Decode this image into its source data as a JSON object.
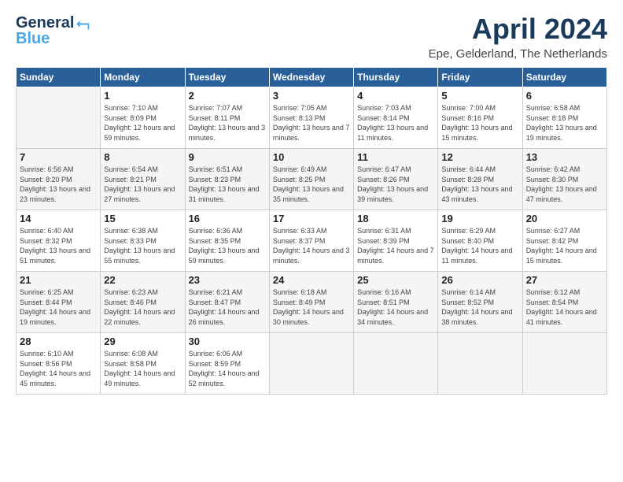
{
  "logo": {
    "line1": "General",
    "line2": "Blue"
  },
  "title": "April 2024",
  "subtitle": "Epe, Gelderland, The Netherlands",
  "weekdays": [
    "Sunday",
    "Monday",
    "Tuesday",
    "Wednesday",
    "Thursday",
    "Friday",
    "Saturday"
  ],
  "weeks": [
    [
      {
        "day": "",
        "sunrise": "",
        "sunset": "",
        "daylight": ""
      },
      {
        "day": "1",
        "sunrise": "Sunrise: 7:10 AM",
        "sunset": "Sunset: 8:09 PM",
        "daylight": "Daylight: 12 hours and 59 minutes."
      },
      {
        "day": "2",
        "sunrise": "Sunrise: 7:07 AM",
        "sunset": "Sunset: 8:11 PM",
        "daylight": "Daylight: 13 hours and 3 minutes."
      },
      {
        "day": "3",
        "sunrise": "Sunrise: 7:05 AM",
        "sunset": "Sunset: 8:13 PM",
        "daylight": "Daylight: 13 hours and 7 minutes."
      },
      {
        "day": "4",
        "sunrise": "Sunrise: 7:03 AM",
        "sunset": "Sunset: 8:14 PM",
        "daylight": "Daylight: 13 hours and 11 minutes."
      },
      {
        "day": "5",
        "sunrise": "Sunrise: 7:00 AM",
        "sunset": "Sunset: 8:16 PM",
        "daylight": "Daylight: 13 hours and 15 minutes."
      },
      {
        "day": "6",
        "sunrise": "Sunrise: 6:58 AM",
        "sunset": "Sunset: 8:18 PM",
        "daylight": "Daylight: 13 hours and 19 minutes."
      }
    ],
    [
      {
        "day": "7",
        "sunrise": "Sunrise: 6:56 AM",
        "sunset": "Sunset: 8:20 PM",
        "daylight": "Daylight: 13 hours and 23 minutes."
      },
      {
        "day": "8",
        "sunrise": "Sunrise: 6:54 AM",
        "sunset": "Sunset: 8:21 PM",
        "daylight": "Daylight: 13 hours and 27 minutes."
      },
      {
        "day": "9",
        "sunrise": "Sunrise: 6:51 AM",
        "sunset": "Sunset: 8:23 PM",
        "daylight": "Daylight: 13 hours and 31 minutes."
      },
      {
        "day": "10",
        "sunrise": "Sunrise: 6:49 AM",
        "sunset": "Sunset: 8:25 PM",
        "daylight": "Daylight: 13 hours and 35 minutes."
      },
      {
        "day": "11",
        "sunrise": "Sunrise: 6:47 AM",
        "sunset": "Sunset: 8:26 PM",
        "daylight": "Daylight: 13 hours and 39 minutes."
      },
      {
        "day": "12",
        "sunrise": "Sunrise: 6:44 AM",
        "sunset": "Sunset: 8:28 PM",
        "daylight": "Daylight: 13 hours and 43 minutes."
      },
      {
        "day": "13",
        "sunrise": "Sunrise: 6:42 AM",
        "sunset": "Sunset: 8:30 PM",
        "daylight": "Daylight: 13 hours and 47 minutes."
      }
    ],
    [
      {
        "day": "14",
        "sunrise": "Sunrise: 6:40 AM",
        "sunset": "Sunset: 8:32 PM",
        "daylight": "Daylight: 13 hours and 51 minutes."
      },
      {
        "day": "15",
        "sunrise": "Sunrise: 6:38 AM",
        "sunset": "Sunset: 8:33 PM",
        "daylight": "Daylight: 13 hours and 55 minutes."
      },
      {
        "day": "16",
        "sunrise": "Sunrise: 6:36 AM",
        "sunset": "Sunset: 8:35 PM",
        "daylight": "Daylight: 13 hours and 59 minutes."
      },
      {
        "day": "17",
        "sunrise": "Sunrise: 6:33 AM",
        "sunset": "Sunset: 8:37 PM",
        "daylight": "Daylight: 14 hours and 3 minutes."
      },
      {
        "day": "18",
        "sunrise": "Sunrise: 6:31 AM",
        "sunset": "Sunset: 8:39 PM",
        "daylight": "Daylight: 14 hours and 7 minutes."
      },
      {
        "day": "19",
        "sunrise": "Sunrise: 6:29 AM",
        "sunset": "Sunset: 8:40 PM",
        "daylight": "Daylight: 14 hours and 11 minutes."
      },
      {
        "day": "20",
        "sunrise": "Sunrise: 6:27 AM",
        "sunset": "Sunset: 8:42 PM",
        "daylight": "Daylight: 14 hours and 15 minutes."
      }
    ],
    [
      {
        "day": "21",
        "sunrise": "Sunrise: 6:25 AM",
        "sunset": "Sunset: 8:44 PM",
        "daylight": "Daylight: 14 hours and 19 minutes."
      },
      {
        "day": "22",
        "sunrise": "Sunrise: 6:23 AM",
        "sunset": "Sunset: 8:46 PM",
        "daylight": "Daylight: 14 hours and 22 minutes."
      },
      {
        "day": "23",
        "sunrise": "Sunrise: 6:21 AM",
        "sunset": "Sunset: 8:47 PM",
        "daylight": "Daylight: 14 hours and 26 minutes."
      },
      {
        "day": "24",
        "sunrise": "Sunrise: 6:18 AM",
        "sunset": "Sunset: 8:49 PM",
        "daylight": "Daylight: 14 hours and 30 minutes."
      },
      {
        "day": "25",
        "sunrise": "Sunrise: 6:16 AM",
        "sunset": "Sunset: 8:51 PM",
        "daylight": "Daylight: 14 hours and 34 minutes."
      },
      {
        "day": "26",
        "sunrise": "Sunrise: 6:14 AM",
        "sunset": "Sunset: 8:52 PM",
        "daylight": "Daylight: 14 hours and 38 minutes."
      },
      {
        "day": "27",
        "sunrise": "Sunrise: 6:12 AM",
        "sunset": "Sunset: 8:54 PM",
        "daylight": "Daylight: 14 hours and 41 minutes."
      }
    ],
    [
      {
        "day": "28",
        "sunrise": "Sunrise: 6:10 AM",
        "sunset": "Sunset: 8:56 PM",
        "daylight": "Daylight: 14 hours and 45 minutes."
      },
      {
        "day": "29",
        "sunrise": "Sunrise: 6:08 AM",
        "sunset": "Sunset: 8:58 PM",
        "daylight": "Daylight: 14 hours and 49 minutes."
      },
      {
        "day": "30",
        "sunrise": "Sunrise: 6:06 AM",
        "sunset": "Sunset: 8:59 PM",
        "daylight": "Daylight: 14 hours and 52 minutes."
      },
      {
        "day": "",
        "sunrise": "",
        "sunset": "",
        "daylight": ""
      },
      {
        "day": "",
        "sunrise": "",
        "sunset": "",
        "daylight": ""
      },
      {
        "day": "",
        "sunrise": "",
        "sunset": "",
        "daylight": ""
      },
      {
        "day": "",
        "sunrise": "",
        "sunset": "",
        "daylight": ""
      }
    ]
  ]
}
